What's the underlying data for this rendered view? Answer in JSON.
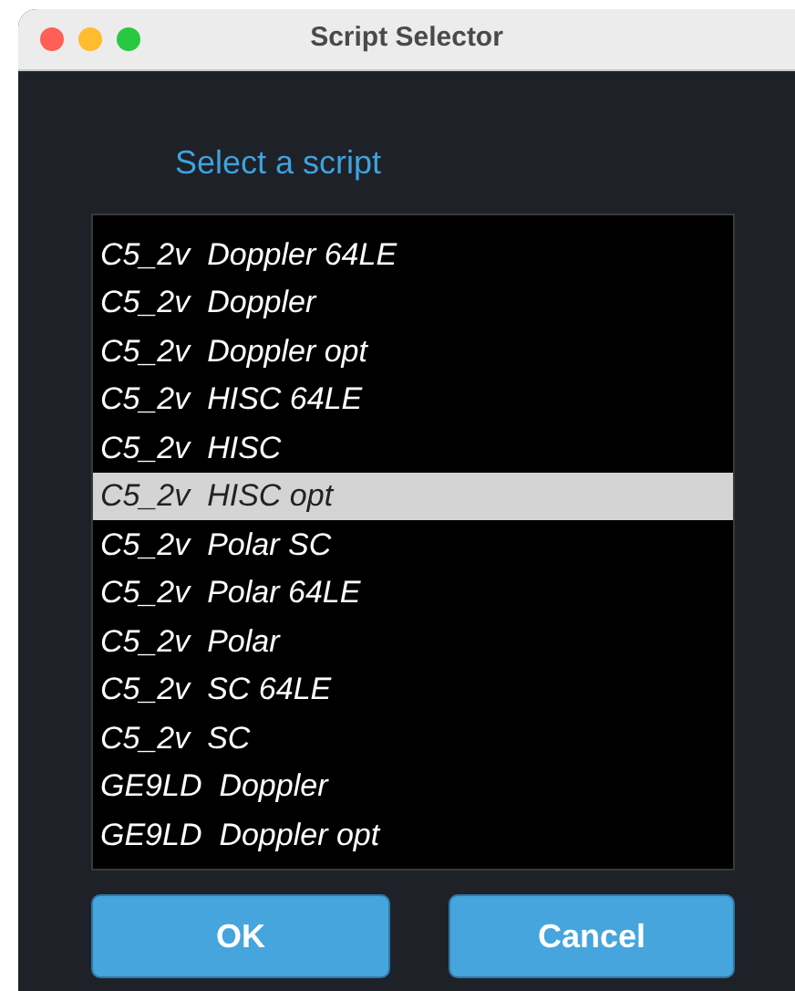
{
  "window": {
    "title": "Script Selector"
  },
  "prompt": "Select a script",
  "scripts": [
    {
      "label": "C5_2v  Doppler 64LE",
      "selected": false
    },
    {
      "label": "C5_2v  Doppler",
      "selected": false
    },
    {
      "label": "C5_2v  Doppler opt",
      "selected": false
    },
    {
      "label": "C5_2v  HISC 64LE",
      "selected": false
    },
    {
      "label": "C5_2v  HISC",
      "selected": false
    },
    {
      "label": "C5_2v  HISC opt",
      "selected": true
    },
    {
      "label": "C5_2v  Polar SC",
      "selected": false
    },
    {
      "label": "C5_2v  Polar 64LE",
      "selected": false
    },
    {
      "label": "C5_2v  Polar",
      "selected": false
    },
    {
      "label": "C5_2v  SC 64LE",
      "selected": false
    },
    {
      "label": "C5_2v  SC",
      "selected": false
    },
    {
      "label": "GE9LD  Doppler",
      "selected": false
    },
    {
      "label": "GE9LD  Doppler opt",
      "selected": false
    }
  ],
  "buttons": [
    "OK",
    "Cancel"
  ]
}
